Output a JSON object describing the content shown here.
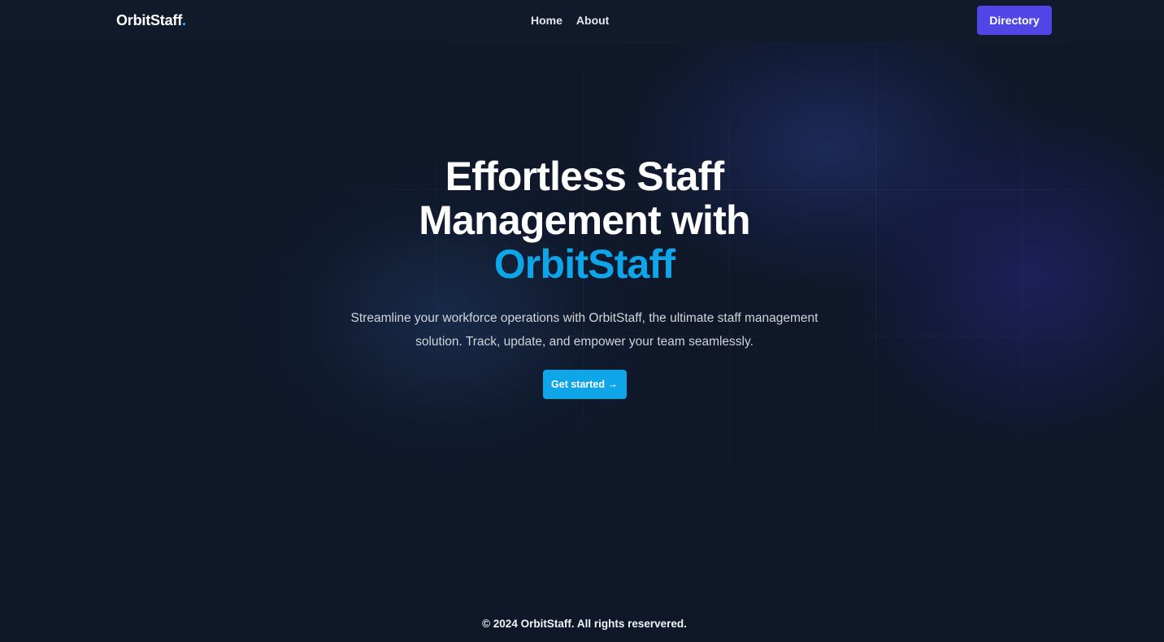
{
  "nav": {
    "logo_text": "OrbitStaff",
    "logo_dot": ".",
    "links": [
      {
        "label": "Home"
      },
      {
        "label": "About"
      }
    ],
    "directory_label": "Directory"
  },
  "hero": {
    "title_line1": "Effortless Staff",
    "title_line2": "Management with",
    "title_accent": "OrbitStaff",
    "subtitle_line1": "Streamline your workforce operations with OrbitStaff, the ultimate staff management",
    "subtitle_line2": "solution. Track, update, and empower your team seamlessly.",
    "cta_label": "Get started →"
  },
  "footer": {
    "copyright": "© 2024 OrbitStaff. All rights reservered."
  },
  "colors": {
    "background": "#0f1728",
    "navbar": "#111a2b",
    "accent": "#0ea5e9",
    "directory_button": "#4f46e5"
  }
}
